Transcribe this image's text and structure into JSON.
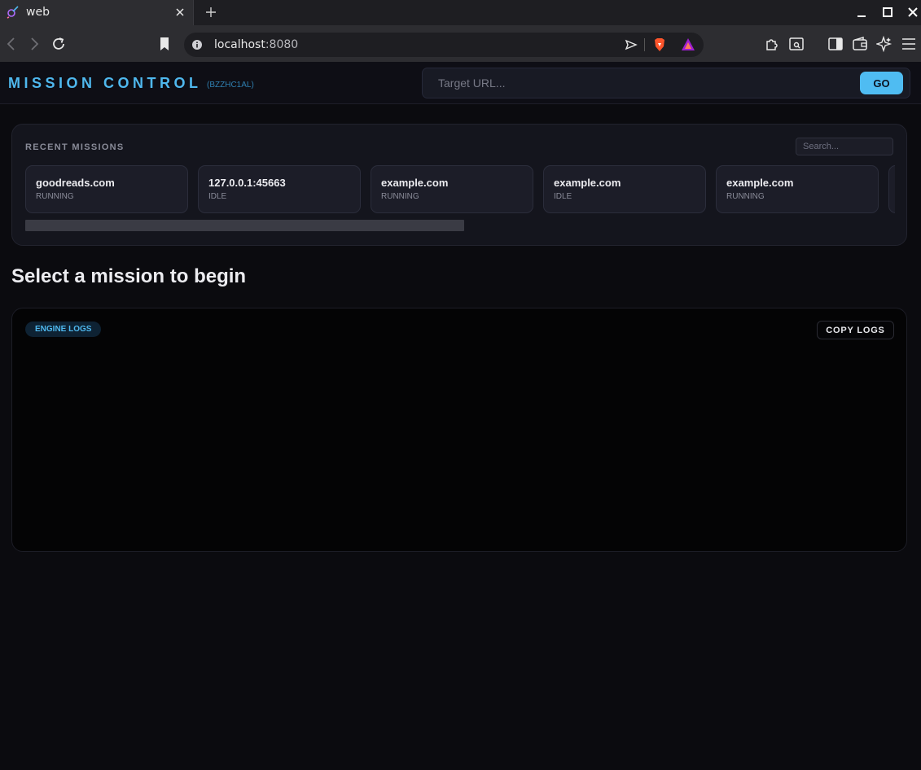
{
  "browser": {
    "tab_title": "web",
    "url_host": "localhost",
    "url_port": ":8080"
  },
  "app": {
    "brand": "MISSION CONTROL",
    "session_id": "(BZZHC1AL)",
    "target_placeholder": "Target URL...",
    "go_label": "GO"
  },
  "missions": {
    "title": "RECENT MISSIONS",
    "search_placeholder": "Search...",
    "cards": [
      {
        "name": "goodreads.com",
        "status": "RUNNING"
      },
      {
        "name": "127.0.0.1:45663",
        "status": "IDLE"
      },
      {
        "name": "example.com",
        "status": "RUNNING"
      },
      {
        "name": "example.com",
        "status": "IDLE"
      },
      {
        "name": "example.com",
        "status": "RUNNING"
      }
    ]
  },
  "main": {
    "heading": "Select a mission to begin"
  },
  "logs": {
    "badge": "ENGINE LOGS",
    "copy_label": "COPY LOGS"
  },
  "colors": {
    "accent": "#4fb8ee",
    "background": "#0b0b0f",
    "panel": "#14151d"
  }
}
